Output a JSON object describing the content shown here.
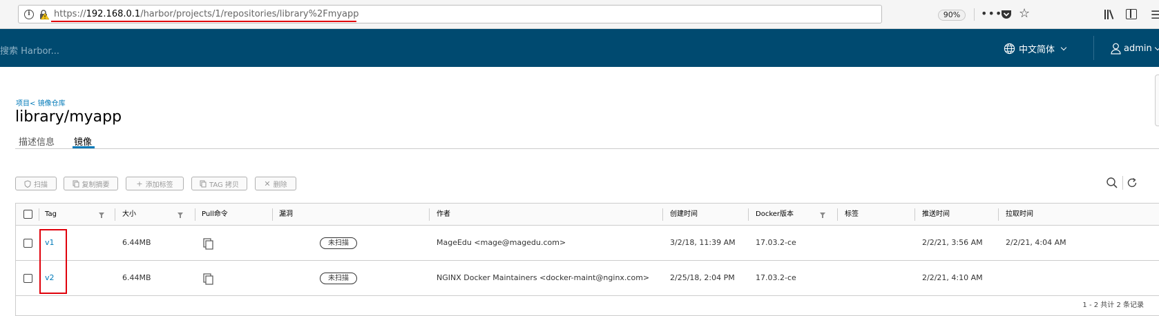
{
  "browser": {
    "url_prefix": "https://",
    "url_host": "192.168.0.1",
    "url_path": "/harbor/projects/1/repositories/library%2Fmyapp",
    "zoom": "90%"
  },
  "header": {
    "search_placeholder": "搜索 Harbor...",
    "language": "中文简体",
    "user": "admin"
  },
  "breadcrumb": {
    "project_label": "项目",
    "separator": "<",
    "repo_label": "镜像仓库"
  },
  "page_title": "library/myapp",
  "tabs": [
    {
      "label": "描述信息"
    },
    {
      "label": "镜像"
    }
  ],
  "toolbar": {
    "scan": "扫描",
    "copy_digest": "复制摘要",
    "add_label": "添加标签",
    "tag_copy": "TAG 拷贝",
    "delete": "删除"
  },
  "table": {
    "columns": {
      "tag": "Tag",
      "size": "大小",
      "pull": "Pull命令",
      "vuln": "漏洞",
      "author": "作者",
      "created": "创建时间",
      "docker": "Docker版本",
      "labels": "标签",
      "pushed": "推送时间",
      "pulled": "拉取时间"
    },
    "rows": [
      {
        "tag": "v1",
        "size": "6.44MB",
        "vuln": "未扫描",
        "author": "MageEdu <mage@magedu.com>",
        "created": "3/2/18, 11:39 AM",
        "docker": "17.03.2-ce",
        "pushed": "2/2/21, 3:56 AM",
        "pulled": "2/2/21, 4:04 AM"
      },
      {
        "tag": "v2",
        "size": "6.44MB",
        "vuln": "未扫描",
        "author": "NGINX Docker Maintainers <docker-maint@nginx.com>",
        "created": "2/25/18, 2:04 PM",
        "docker": "17.03.2-ce",
        "pushed": "2/2/21, 4:10 AM",
        "pulled": ""
      }
    ],
    "footer": "1 - 2 共计 2 条记录"
  },
  "colors": {
    "header_bg": "#004a70",
    "link": "#0079b8",
    "highlight": "#e0000a"
  }
}
